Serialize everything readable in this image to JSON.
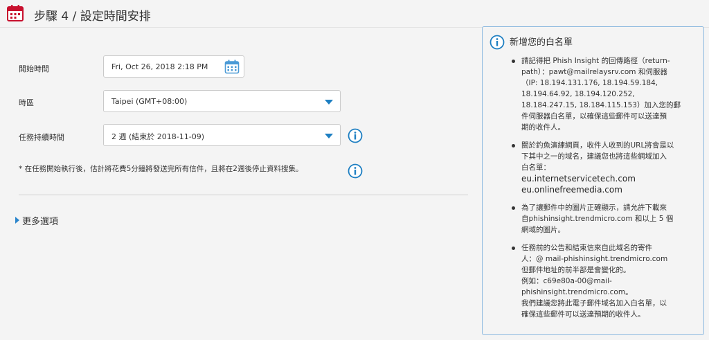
{
  "header": {
    "title": "步驟 4 / 設定時間安排"
  },
  "form": {
    "start_time": {
      "label": "開始時間",
      "value": "Fri, Oct 26, 2018 2:18 PM"
    },
    "timezone": {
      "label": "時區",
      "value": "Taipei (GMT+08:00)"
    },
    "duration": {
      "label": "任務持續時間",
      "value": "2 週 (結束於 2018-11-09)"
    },
    "note": "* 在任務開始執行後，估計將花費5分鐘將發送完所有信件，且將在2週後停止資料搜集。"
  },
  "more_options": {
    "label": "更多選項"
  },
  "whitelist_panel": {
    "title": "新增您的白名單",
    "items": [
      {
        "lines": [
          "請記得把 Phish Insight 的回傳路徑（return-",
          "path）：pawt@mailrelaysrv.com 和伺服器",
          "（IP: 18.194.131.176, 18.194.59.184,",
          "18.194.64.92, 18.194.120.252,",
          "18.184.247.15, 18.184.115.153）加入您的郵",
          "件伺服器白名單，以確保這些郵件可以送達預",
          "期的收件人。"
        ]
      },
      {
        "lines": [
          "關於釣魚演練網頁，收件人收到的URL將會是以",
          "下其中之一的域名，建議您也將這些網域加入",
          "白名單："
        ],
        "domains": [
          "eu.internetservicetech.com",
          "eu.onlinefreemedia.com"
        ]
      },
      {
        "lines": [
          "為了讓郵件中的圖片正確顯示，請允許下載來",
          "自phishinsight.trendmicro.com 和以上 5 個",
          "網域的圖片。"
        ]
      },
      {
        "lines": [
          "任務前的公告和結束信來自此域名的寄件",
          "人：@ mail-phishinsight.trendmicro.com",
          "但郵件地址的前半部是會變化的。",
          "例如：c69e80a-00@mail-",
          "phishinsight.trendmicro.com。",
          "我們建議您將此電子郵件域名加入白名單，以",
          "確保這些郵件可以送達預期的收件人。"
        ]
      }
    ]
  },
  "colors": {
    "accent": "#1e7fc2",
    "icon_red": "#c8102e",
    "panel_border": "#8bb8df"
  }
}
